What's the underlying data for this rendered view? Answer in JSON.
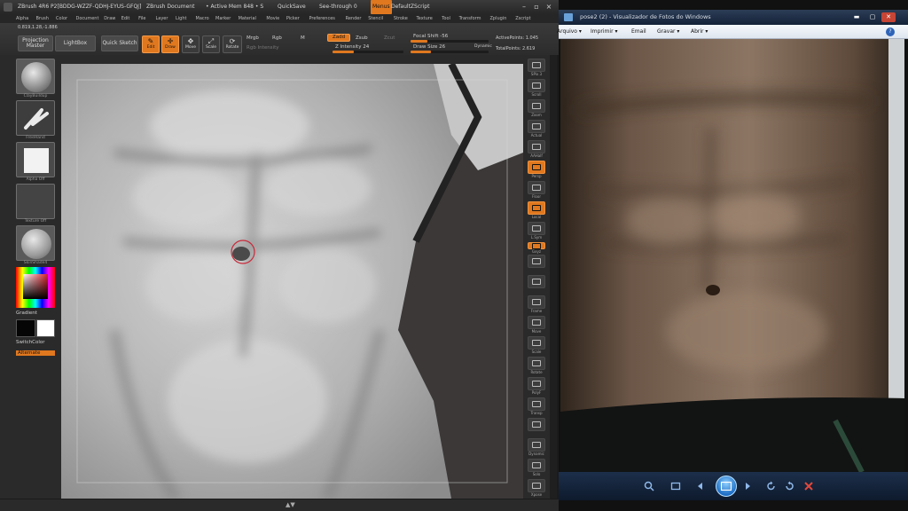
{
  "zbrush": {
    "title_app": "ZBrush 4R6 P2[BDDG-WZZF-QDHJ-EYUS-GFQJ]",
    "title_doc": "ZBrush Document",
    "title_mem": "• Active Mem 848 • S",
    "title_quicksave": "QuickSave",
    "title_seethrough": "See-through  0",
    "title_menus": "Menus",
    "title_script": "DefaultZScript",
    "menubar": [
      "Alpha",
      "Brush",
      "Color",
      "Document",
      "Draw",
      "Edit",
      "File",
      "Layer",
      "Light",
      "Macro",
      "Marker",
      "Material",
      "Movie",
      "Picker",
      "Preferences",
      "Render",
      "Stencil",
      "Stroke",
      "Texture",
      "Tool",
      "Transform",
      "Zplugin",
      "Zscript"
    ],
    "coords": "0.819,1.28,-1.886",
    "projection_master": "Projection Master",
    "lightbox": "LightBox",
    "quick_sketch": "Quick Sketch",
    "edit_label": "Edit",
    "draw_label": "Draw",
    "move_label": "Move",
    "scale_label": "Scale",
    "rotate_label": "Rotate",
    "mrgb": "Mrgb",
    "rgb": "Rgb",
    "m": "M",
    "zadd": "Zadd",
    "zsub": "Zsub",
    "zcut": "Zcut",
    "rgb_intensity": "Rgb Intensity",
    "z_intensity": "Z Intensity 24",
    "focal_shift": "Focal Shift -56",
    "draw_size": "Draw Size 26",
    "dynamic": "Dynamic",
    "active_points": "ActivePoints: 1.045",
    "total_points": "TotalPoints: 2.619",
    "left": {
      "brush_caption": "ClayBuildup",
      "stroke_caption": "FreeHand",
      "alpha_caption": "Alpha Off",
      "texture_caption": "Texture Off",
      "material_caption": "SkinShade4",
      "gradient": "Gradient",
      "switch_color": "SwitchColor",
      "alternate": "Alternate"
    },
    "right": [
      "SPix 3",
      "Scroll",
      "Zoom",
      "Actual",
      "AAHalf",
      "Persp",
      "Floor",
      "Local",
      "L.Sym",
      "Gxyz",
      "",
      "",
      "Frame",
      "Move",
      "Scale",
      "Rotate",
      "PolyF",
      "Transp",
      "",
      "Dynamic",
      "Solo",
      "Xpose"
    ],
    "slider_z_intensity": 0.24,
    "slider_focal_shift": 0.22,
    "slider_draw_size": 0.26
  },
  "viewer": {
    "title": "pose2 (2) - Visualizador de Fotos do Windows",
    "menu": [
      "Arquivo ▾",
      "Imprimir ▾",
      "Email",
      "Gravar ▾",
      "Abrir ▾"
    ],
    "help": "?",
    "minimize": "▬",
    "maximize": "▢",
    "close": "✕"
  },
  "colors": {
    "accent": "#e0781f",
    "zb_bg": "#2a2a2a",
    "viewer_title": "#1c2f4a"
  }
}
